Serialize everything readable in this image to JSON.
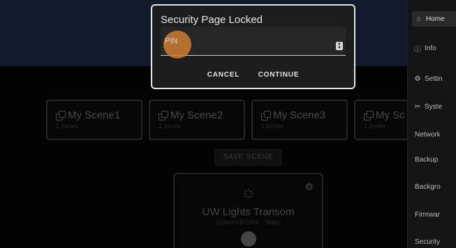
{
  "dialog": {
    "title": "Security Page Locked",
    "pin_placeholder": "PIN",
    "cancel_label": "CANCEL",
    "continue_label": "CONTINUE"
  },
  "scenes": [
    {
      "name": "My Scene1",
      "zones": "1 zones"
    },
    {
      "name": "My Scene2",
      "zones": "1 zones"
    },
    {
      "name": "My Scene3",
      "zones": "1 zones"
    },
    {
      "name": "My Sc",
      "zones": "1 zones"
    }
  ],
  "save_scene_label": "SAVE SCENE",
  "light": {
    "name": "UW Lights Transom",
    "type": "Colours RGBW - Static",
    "icon": "sun-icon"
  },
  "sidebar": {
    "items": [
      {
        "label": "Home",
        "icon": "home-icon"
      },
      {
        "label": "Info",
        "icon": "info-icon"
      },
      {
        "label": "Settin",
        "icon": "gears-icon"
      },
      {
        "label": "Syste",
        "icon": "tools-icon"
      },
      {
        "label": "Network"
      },
      {
        "label": "Backup"
      },
      {
        "label": "Backgro"
      },
      {
        "label": "Firmwar"
      },
      {
        "label": "Security"
      }
    ]
  },
  "colors": {
    "header": "#1b2a44",
    "accent_cursor": "#ce7e34",
    "dialog_border": "#e6e6e6"
  }
}
